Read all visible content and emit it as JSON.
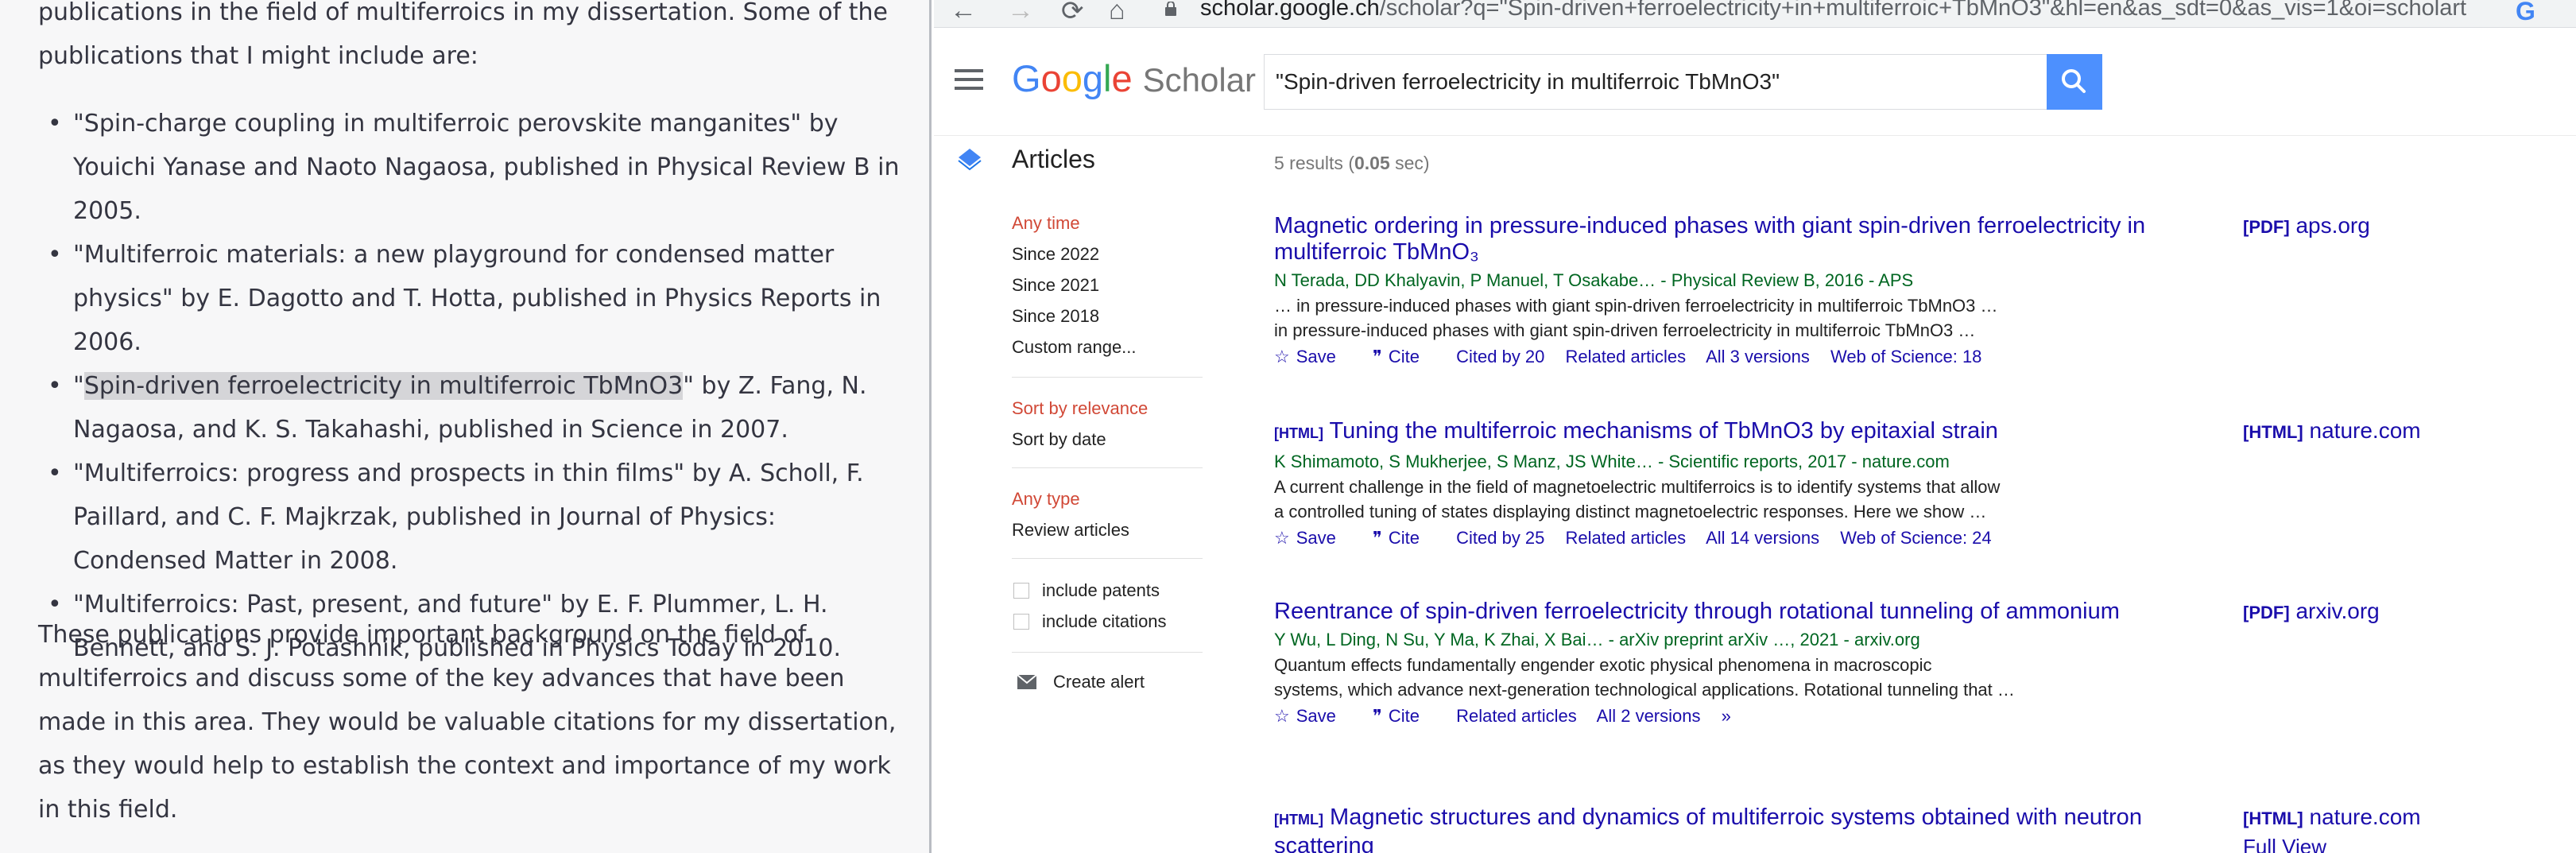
{
  "chat": {
    "intro": "publications in the field of multiferroics in my dissertation. Some of the publications that I might include are:",
    "items": [
      {
        "pre": "\"Spin-charge coupling in multiferroic perovskite manganites\" by Youichi Yanase and Naoto Nagaosa, published in Physical Review B in 2005.",
        "hl": "",
        "post": ""
      },
      {
        "pre": "\"Multiferroic materials: a new playground for condensed matter physics\" by E. Dagotto and T. Hotta, published in Physics Reports in 2006.",
        "hl": "",
        "post": ""
      },
      {
        "pre": "\"",
        "hl": "Spin-driven ferroelectricity in multiferroic TbMnO3",
        "post": "\" by Z. Fang, N. Nagaosa, and K. S. Takahashi, published in Science in 2007."
      },
      {
        "pre": "\"Multiferroics: progress and prospects in thin films\" by A. Scholl, F. Paillard, and C. F. Majkrzak, published in Journal of Physics: Condensed Matter in 2008.",
        "hl": "",
        "post": ""
      },
      {
        "pre": "\"Multiferroics: Past, present, and future\" by E. F. Plummer, L. H. Bennett, and S. J. Potashnik, published in Physics Today in 2010.",
        "hl": "",
        "post": ""
      }
    ],
    "outro": "These publications provide important background on the field of multiferroics and discuss some of the key advances that have been made in this area. They would be valuable citations for my dissertation, as they would help to establish the context and importance of my work in this field."
  },
  "browser": {
    "url_main": "scholar.google.ch",
    "url_rest": "/scholar?q=\"Spin-driven+ferroelectricity+in+multiferroic+TbMnO3\"&hl=en&as_sdt=0&as_vis=1&oi=scholart",
    "back_icon": "←",
    "forward_icon": "→",
    "reload_icon": "⟳",
    "home_icon": "⌂",
    "account_icon": "G"
  },
  "scholar": {
    "logo_letters": [
      "G",
      "o",
      "o",
      "g",
      "l",
      "e"
    ],
    "logo_colors": [
      "#4285f4",
      "#ea4335",
      "#fbbc05",
      "#4285f4",
      "#34a853",
      "#ea4335"
    ],
    "logo_suffix": "Scholar",
    "search_value": "\"Spin-driven ferroelectricity in multiferroic TbMnO3\"",
    "articles_label": "Articles",
    "results_prefix": "5 results (",
    "results_time": "0.05",
    "results_suffix": " sec)",
    "sidebar": {
      "time": [
        "Any time",
        "Since 2022",
        "Since 2021",
        "Since 2018",
        "Custom range..."
      ],
      "sort": [
        "Sort by relevance",
        "Sort by date"
      ],
      "type": [
        "Any type",
        "Review articles"
      ],
      "checks": [
        "include patents",
        "include citations"
      ],
      "alert": "Create alert"
    },
    "results": [
      {
        "tag": "",
        "title": "Magnetic ordering in pressure-induced phases with giant spin-driven ferroelectricity in multiferroic TbMnO₃",
        "authors": "N Terada, DD Khalyavin, P Manuel, T Osakabe… - Physical Review B, 2016 - APS",
        "snippet": [
          "… in pressure-induced phases with giant spin-driven ferroelectricity in multiferroic TbMnO3 …",
          "in pressure-induced phases with giant spin-driven ferroelectricity in multiferroic TbMnO3 …"
        ],
        "actions": [
          "Save",
          "Cite",
          "Cited by 20",
          "Related articles",
          "All 3 versions",
          "Web of Science: 18"
        ],
        "side_tag": "[PDF]",
        "side_site": "aps.org"
      },
      {
        "tag": "[HTML]",
        "title": "Tuning the multiferroic mechanisms of TbMnO3 by epitaxial strain",
        "authors": "K Shimamoto, S Mukherjee, S Manz, JS White… - Scientific reports, 2017 - nature.com",
        "snippet": [
          "A current challenge in the field of magnetoelectric multiferroics is to identify systems that allow",
          "a controlled tuning of states displaying distinct magnetoelectric responses. Here we show …"
        ],
        "actions": [
          "Save",
          "Cite",
          "Cited by 25",
          "Related articles",
          "All 14 versions",
          "Web of Science: 24"
        ],
        "side_tag": "[HTML]",
        "side_site": "nature.com"
      },
      {
        "tag": "",
        "title": "Reentrance of spin-driven ferroelectricity through rotational tunneling of ammonium",
        "authors": "Y Wu, L Ding, N Su, Y Ma, K Zhai, X Bai… - arXiv preprint arXiv …, 2021 - arxiv.org",
        "snippet": [
          "Quantum effects fundamentally engender exotic physical phenomena in macroscopic",
          "systems, which advance next-generation technological applications. Rotational tunneling that …"
        ],
        "actions": [
          "Save",
          "Cite",
          "Related articles",
          "All 2 versions",
          "»"
        ],
        "side_tag": "[PDF]",
        "side_site": "arxiv.org"
      },
      {
        "tag": "[HTML]",
        "title": "Magnetic structures and dynamics of multiferroic systems obtained with neutron scattering",
        "authors": "",
        "snippet": [],
        "actions": [],
        "side_tag": "[HTML]",
        "side_site": "nature.com",
        "side_extra": "Full View"
      }
    ]
  }
}
